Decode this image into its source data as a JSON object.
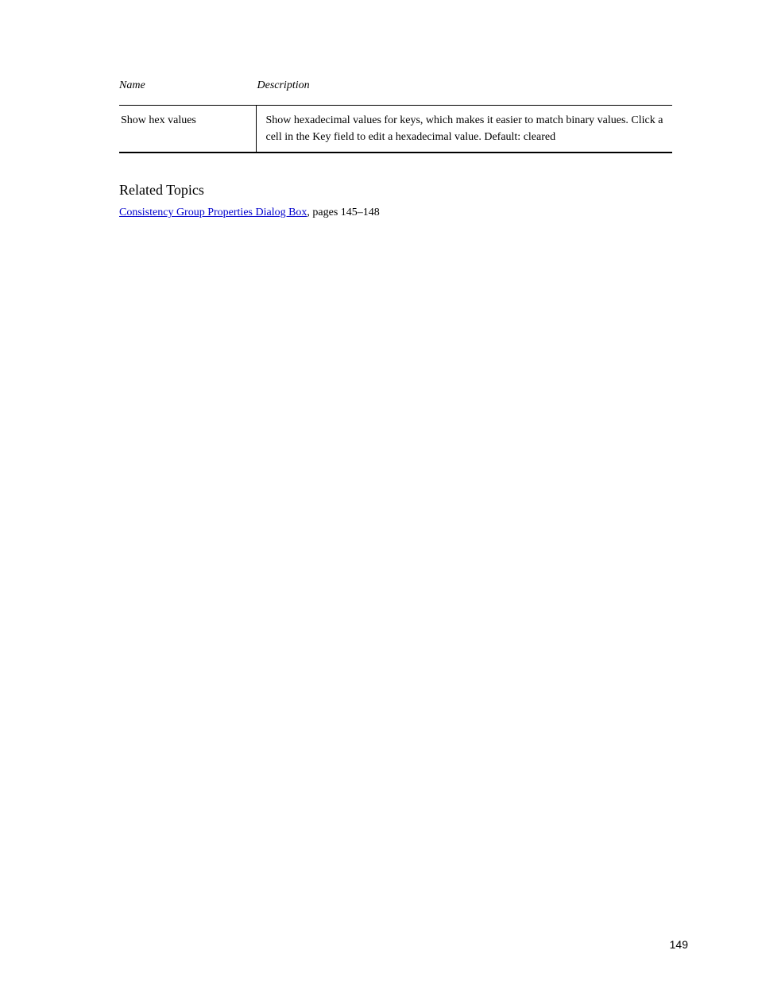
{
  "columnHeaders": {
    "name": "Name",
    "description": "Description"
  },
  "tableRow": {
    "name": "Show hex values",
    "description": "Show hexadecimal values for keys, which makes it easier to match binary values. Click a cell in the Key field to edit a hexadecimal value. Default: cleared"
  },
  "related": {
    "heading": "Related Topics",
    "linkText": "Consistency Group Properties Dialog Box",
    "pages": ", pages 145–148"
  },
  "pageNumber": "149"
}
